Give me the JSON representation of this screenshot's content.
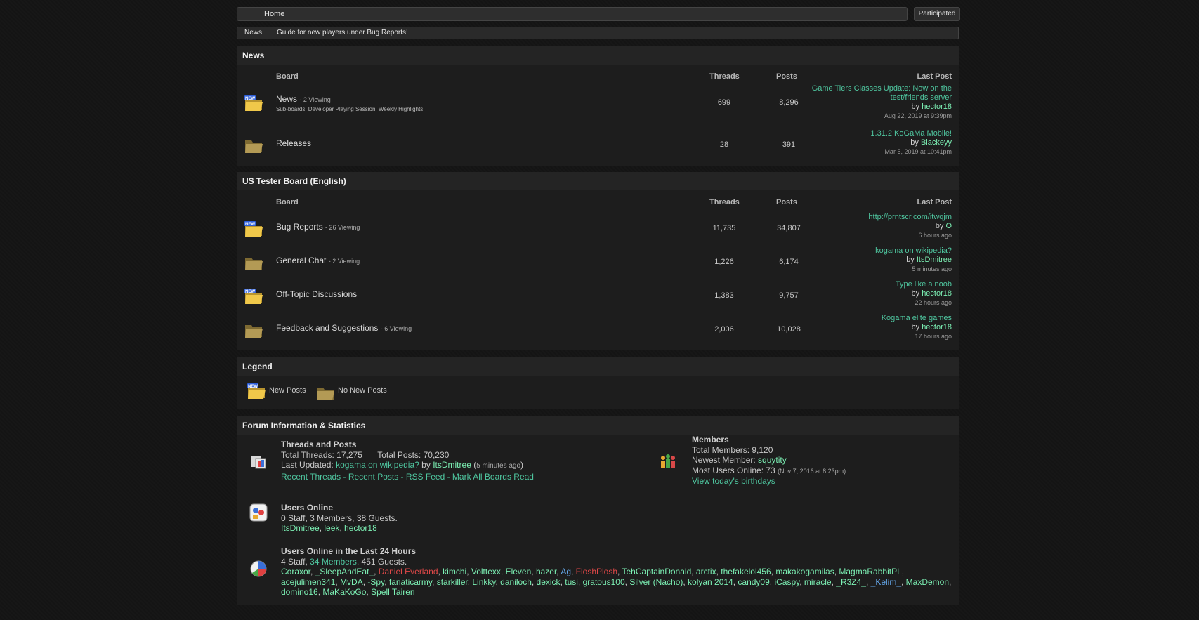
{
  "nav": {
    "home_label": "Home",
    "participated_label": "Participated"
  },
  "news_ticker": {
    "label": "News",
    "text": "Guide for new players under Bug Reports!"
  },
  "columns": {
    "board": "Board",
    "threads": "Threads",
    "posts": "Posts",
    "last_post": "Last Post"
  },
  "categories": [
    {
      "title": "News",
      "boards": [
        {
          "name": "News",
          "viewing": "- 2 Viewing",
          "subboards": "Sub-boards: Developer Playing Session, Weekly Highlights",
          "threads": "699",
          "posts": "8,296",
          "last_title": "Game Tiers Classes Update: Now on the test/friends server",
          "by_label": "by",
          "last_user": "hector18",
          "last_date": "Aug 22, 2019 at 9:39pm",
          "new": true
        },
        {
          "name": "Releases",
          "viewing": "",
          "subboards": "",
          "threads": "28",
          "posts": "391",
          "last_title": "1.31.2 KoGaMa Mobile!",
          "by_label": "by",
          "last_user": "Blackeyy",
          "last_date": "Mar 5, 2019 at 10:41pm",
          "new": false
        }
      ]
    },
    {
      "title": "US Tester Board (English)",
      "boards": [
        {
          "name": "Bug Reports",
          "viewing": "- 26 Viewing",
          "subboards": "",
          "threads": "11,735",
          "posts": "34,807",
          "last_title": "http://prntscr.com/itwqjm",
          "by_label": "by",
          "last_user": "O",
          "last_date": "6 hours ago",
          "new": true
        },
        {
          "name": "General Chat",
          "viewing": "- 2 Viewing",
          "subboards": "",
          "threads": "1,226",
          "posts": "6,174",
          "last_title": "kogama on wikipedia?",
          "by_label": "by",
          "last_user": "ItsDmitree",
          "last_date": "5 minutes ago",
          "new": false
        },
        {
          "name": "Off-Topic Discussions",
          "viewing": "",
          "subboards": "",
          "threads": "1,383",
          "posts": "9,757",
          "last_title": "Type like a noob",
          "by_label": "by",
          "last_user": "hector18",
          "last_date": "22 hours ago",
          "new": true
        },
        {
          "name": "Feedback and Suggestions",
          "viewing": "- 6 Viewing",
          "subboards": "",
          "threads": "2,006",
          "posts": "10,028",
          "last_title": "Kogama elite games",
          "by_label": "by",
          "last_user": "hector18",
          "last_date": "17 hours ago",
          "new": false
        }
      ]
    }
  ],
  "legend": {
    "title": "Legend",
    "new_posts": "New Posts",
    "no_new_posts": "No New Posts"
  },
  "stats": {
    "title": "Forum Information & Statistics",
    "threads_posts": {
      "title": "Threads and Posts",
      "total_threads_label": "Total Threads:",
      "total_threads": "17,275",
      "total_posts_label": "Total Posts:",
      "total_posts": "70,230",
      "last_updated_label": "Last Updated:",
      "last_updated_thread": "kogama on wikipedia?",
      "by_label": "by",
      "last_updated_user": "ItsDmitree",
      "last_updated_time": "5 minutes ago",
      "links": [
        "Recent Threads",
        "Recent Posts",
        "RSS Feed",
        "Mark All Boards Read"
      ]
    },
    "members": {
      "title": "Members",
      "total_label": "Total Members:",
      "total": "9,120",
      "newest_label": "Newest Member:",
      "newest": "squytity",
      "most_online_label": "Most Users Online:",
      "most_online": "73",
      "most_online_date": "(Nov 7, 2016 at 8:23pm)",
      "birthdays": "View today's birthdays"
    },
    "users_online": {
      "title": "Users Online",
      "summary": "0 Staff, 3 Members, 38 Guests.",
      "users": [
        "ItsDmitree",
        "leek",
        "hector18"
      ]
    },
    "last24": {
      "title": "Users Online in the Last 24 Hours",
      "staff": "4 Staff,",
      "members": "34 Members",
      "guests": ", 451 Guests.",
      "users": [
        {
          "n": "Coraxor",
          "c": "g"
        },
        {
          "n": "_SleepAndEat_",
          "c": "g"
        },
        {
          "n": "Daniel Everland",
          "c": "r"
        },
        {
          "n": "kimchi",
          "c": "g"
        },
        {
          "n": "Volttexx",
          "c": "g"
        },
        {
          "n": "Eleven",
          "c": "g"
        },
        {
          "n": "hazer",
          "c": "g"
        },
        {
          "n": "Ag",
          "c": "b"
        },
        {
          "n": "FloshPlosh",
          "c": "r"
        },
        {
          "n": "TehCaptainDonald",
          "c": "g"
        },
        {
          "n": "arctix",
          "c": "g"
        },
        {
          "n": "thefakelol456",
          "c": "g"
        },
        {
          "n": "makakogamilas",
          "c": "g"
        },
        {
          "n": "MagmaRabbitPL",
          "c": "g"
        },
        {
          "n": "acejulimen341",
          "c": "g"
        },
        {
          "n": "MvDA",
          "c": "g"
        },
        {
          "n": "-Spy",
          "c": "g"
        },
        {
          "n": "fanaticarmy",
          "c": "g"
        },
        {
          "n": "starkiller",
          "c": "g"
        },
        {
          "n": "Linkky",
          "c": "g"
        },
        {
          "n": "daniloch",
          "c": "g"
        },
        {
          "n": "dexick",
          "c": "g"
        },
        {
          "n": "tusi",
          "c": "g"
        },
        {
          "n": "gratous100",
          "c": "g"
        },
        {
          "n": "Silver (Nacho)",
          "c": "g"
        },
        {
          "n": "kolyan 2014",
          "c": "g"
        },
        {
          "n": "candy09",
          "c": "g"
        },
        {
          "n": "iCaspy",
          "c": "g"
        },
        {
          "n": "miracle",
          "c": "g"
        },
        {
          "n": "_R3Z4_",
          "c": "g"
        },
        {
          "n": "_Kelim_",
          "c": "b"
        },
        {
          "n": "MaxDemon",
          "c": "g"
        },
        {
          "n": "domino16",
          "c": "g"
        },
        {
          "n": "MaKaKoGo",
          "c": "g"
        },
        {
          "n": "Spell Tairen",
          "c": "g"
        }
      ]
    }
  }
}
